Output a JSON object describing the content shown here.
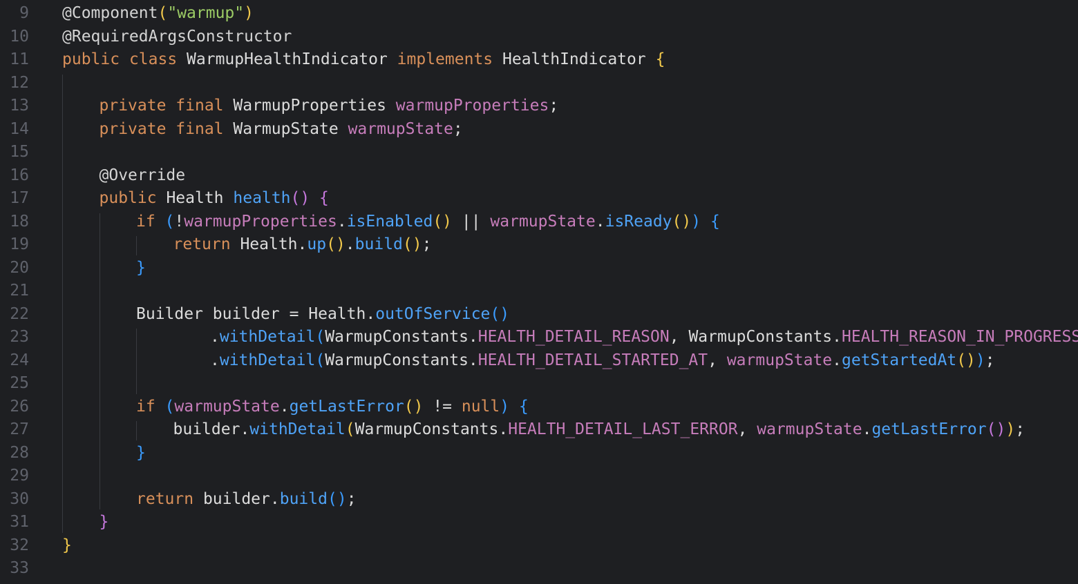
{
  "editor": {
    "theme": {
      "background": "#1e1f22",
      "line_number": "#5f626b",
      "keyword": "#d9905a",
      "string": "#9ccc65",
      "field": "#c77dbb",
      "function": "#4fa3f7",
      "text": "#dcdcdc",
      "paren_yellow": "#f2c94c",
      "paren_purple": "#c678dd",
      "paren_blue": "#3b9cff"
    },
    "lines": [
      {
        "n": "9",
        "indent": 0,
        "tokens": [
          {
            "t": "@Component",
            "c": "ann"
          },
          {
            "t": "(",
            "c": "p1"
          },
          {
            "t": "\"warmup\"",
            "c": "str"
          },
          {
            "t": ")",
            "c": "p1"
          }
        ]
      },
      {
        "n": "10",
        "indent": 0,
        "tokens": [
          {
            "t": "@RequiredArgsConstructor",
            "c": "ann"
          }
        ]
      },
      {
        "n": "11",
        "indent": 0,
        "tokens": [
          {
            "t": "public ",
            "c": "kw"
          },
          {
            "t": "class ",
            "c": "kw"
          },
          {
            "t": "WarmupHealthIndicator ",
            "c": "type"
          },
          {
            "t": "implements ",
            "c": "kw"
          },
          {
            "t": "HealthIndicator ",
            "c": "type"
          },
          {
            "t": "{",
            "c": "p1"
          }
        ]
      },
      {
        "n": "12",
        "indent": 0,
        "tokens": []
      },
      {
        "n": "13",
        "indent": 1,
        "tokens": [
          {
            "t": "private ",
            "c": "kw"
          },
          {
            "t": "final ",
            "c": "kw"
          },
          {
            "t": "WarmupProperties ",
            "c": "type"
          },
          {
            "t": "warmupProperties",
            "c": "field"
          },
          {
            "t": ";",
            "c": "punc"
          }
        ]
      },
      {
        "n": "14",
        "indent": 1,
        "tokens": [
          {
            "t": "private ",
            "c": "kw"
          },
          {
            "t": "final ",
            "c": "kw"
          },
          {
            "t": "WarmupState ",
            "c": "type"
          },
          {
            "t": "warmupState",
            "c": "field"
          },
          {
            "t": ";",
            "c": "punc"
          }
        ]
      },
      {
        "n": "15",
        "indent": 0,
        "tokens": []
      },
      {
        "n": "16",
        "indent": 1,
        "tokens": [
          {
            "t": "@Override",
            "c": "ann"
          }
        ]
      },
      {
        "n": "17",
        "indent": 1,
        "tokens": [
          {
            "t": "public ",
            "c": "kw"
          },
          {
            "t": "Health ",
            "c": "type"
          },
          {
            "t": "health",
            "c": "fn"
          },
          {
            "t": "() ",
            "c": "p2"
          },
          {
            "t": "{",
            "c": "p2"
          }
        ]
      },
      {
        "n": "18",
        "indent": 2,
        "tokens": [
          {
            "t": "if ",
            "c": "kw"
          },
          {
            "t": "(",
            "c": "p3"
          },
          {
            "t": "!",
            "c": "punc"
          },
          {
            "t": "warmupProperties",
            "c": "field"
          },
          {
            "t": ".",
            "c": "punc"
          },
          {
            "t": "isEnabled",
            "c": "fn"
          },
          {
            "t": "()",
            "c": "p1"
          },
          {
            "t": " || ",
            "c": "punc"
          },
          {
            "t": "warmupState",
            "c": "field"
          },
          {
            "t": ".",
            "c": "punc"
          },
          {
            "t": "isReady",
            "c": "fn"
          },
          {
            "t": "()",
            "c": "p1"
          },
          {
            "t": ") ",
            "c": "p3"
          },
          {
            "t": "{",
            "c": "p3"
          }
        ]
      },
      {
        "n": "19",
        "indent": 3,
        "tokens": [
          {
            "t": "return ",
            "c": "kw"
          },
          {
            "t": "Health",
            "c": "type"
          },
          {
            "t": ".",
            "c": "punc"
          },
          {
            "t": "up",
            "c": "fn"
          },
          {
            "t": "()",
            "c": "p1"
          },
          {
            "t": ".",
            "c": "punc"
          },
          {
            "t": "build",
            "c": "fn"
          },
          {
            "t": "()",
            "c": "p1"
          },
          {
            "t": ";",
            "c": "punc"
          }
        ]
      },
      {
        "n": "20",
        "indent": 2,
        "tokens": [
          {
            "t": "}",
            "c": "p3"
          }
        ]
      },
      {
        "n": "21",
        "indent": 0,
        "tokens": []
      },
      {
        "n": "22",
        "indent": 2,
        "tokens": [
          {
            "t": "Builder ",
            "c": "type"
          },
          {
            "t": "builder ",
            "c": "type"
          },
          {
            "t": "= ",
            "c": "punc"
          },
          {
            "t": "Health",
            "c": "type"
          },
          {
            "t": ".",
            "c": "punc"
          },
          {
            "t": "outOfService",
            "c": "fn"
          },
          {
            "t": "()",
            "c": "p3"
          }
        ]
      },
      {
        "n": "23",
        "indent": 4,
        "tokens": [
          {
            "t": ".",
            "c": "punc"
          },
          {
            "t": "withDetail",
            "c": "fn"
          },
          {
            "t": "(",
            "c": "p3"
          },
          {
            "t": "WarmupConstants",
            "c": "type"
          },
          {
            "t": ".",
            "c": "punc"
          },
          {
            "t": "HEALTH_DETAIL_REASON",
            "c": "const"
          },
          {
            "t": ", ",
            "c": "punc"
          },
          {
            "t": "WarmupConstants",
            "c": "type"
          },
          {
            "t": ".",
            "c": "punc"
          },
          {
            "t": "HEALTH_REASON_IN_PROGRESS",
            "c": "const"
          },
          {
            "t": ")",
            "c": "p3"
          }
        ]
      },
      {
        "n": "24",
        "indent": 4,
        "tokens": [
          {
            "t": ".",
            "c": "punc"
          },
          {
            "t": "withDetail",
            "c": "fn"
          },
          {
            "t": "(",
            "c": "p3"
          },
          {
            "t": "WarmupConstants",
            "c": "type"
          },
          {
            "t": ".",
            "c": "punc"
          },
          {
            "t": "HEALTH_DETAIL_STARTED_AT",
            "c": "const"
          },
          {
            "t": ", ",
            "c": "punc"
          },
          {
            "t": "warmupState",
            "c": "field"
          },
          {
            "t": ".",
            "c": "punc"
          },
          {
            "t": "getStartedAt",
            "c": "fn"
          },
          {
            "t": "()",
            "c": "p1"
          },
          {
            "t": ")",
            "c": "p3"
          },
          {
            "t": ";",
            "c": "punc"
          }
        ]
      },
      {
        "n": "25",
        "indent": 0,
        "tokens": []
      },
      {
        "n": "26",
        "indent": 2,
        "tokens": [
          {
            "t": "if ",
            "c": "kw"
          },
          {
            "t": "(",
            "c": "p3"
          },
          {
            "t": "warmupState",
            "c": "field"
          },
          {
            "t": ".",
            "c": "punc"
          },
          {
            "t": "getLastError",
            "c": "fn"
          },
          {
            "t": "()",
            "c": "p1"
          },
          {
            "t": " != ",
            "c": "punc"
          },
          {
            "t": "null",
            "c": "kw"
          },
          {
            "t": ") ",
            "c": "p3"
          },
          {
            "t": "{",
            "c": "p3"
          }
        ]
      },
      {
        "n": "27",
        "indent": 3,
        "tokens": [
          {
            "t": "builder",
            "c": "type"
          },
          {
            "t": ".",
            "c": "punc"
          },
          {
            "t": "withDetail",
            "c": "fn"
          },
          {
            "t": "(",
            "c": "p1"
          },
          {
            "t": "WarmupConstants",
            "c": "type"
          },
          {
            "t": ".",
            "c": "punc"
          },
          {
            "t": "HEALTH_DETAIL_LAST_ERROR",
            "c": "const"
          },
          {
            "t": ", ",
            "c": "punc"
          },
          {
            "t": "warmupState",
            "c": "field"
          },
          {
            "t": ".",
            "c": "punc"
          },
          {
            "t": "getLastError",
            "c": "fn"
          },
          {
            "t": "()",
            "c": "p2"
          },
          {
            "t": ")",
            "c": "p1"
          },
          {
            "t": ";",
            "c": "punc"
          }
        ]
      },
      {
        "n": "28",
        "indent": 2,
        "tokens": [
          {
            "t": "}",
            "c": "p3"
          }
        ]
      },
      {
        "n": "29",
        "indent": 0,
        "tokens": []
      },
      {
        "n": "30",
        "indent": 2,
        "tokens": [
          {
            "t": "return ",
            "c": "kw"
          },
          {
            "t": "builder",
            "c": "type"
          },
          {
            "t": ".",
            "c": "punc"
          },
          {
            "t": "build",
            "c": "fn"
          },
          {
            "t": "()",
            "c": "p3"
          },
          {
            "t": ";",
            "c": "punc"
          }
        ]
      },
      {
        "n": "31",
        "indent": 1,
        "tokens": [
          {
            "t": "}",
            "c": "p2"
          }
        ]
      },
      {
        "n": "32",
        "indent": 0,
        "tokens": [
          {
            "t": "}",
            "c": "p1"
          }
        ]
      },
      {
        "n": "33",
        "indent": 0,
        "tokens": []
      }
    ]
  }
}
